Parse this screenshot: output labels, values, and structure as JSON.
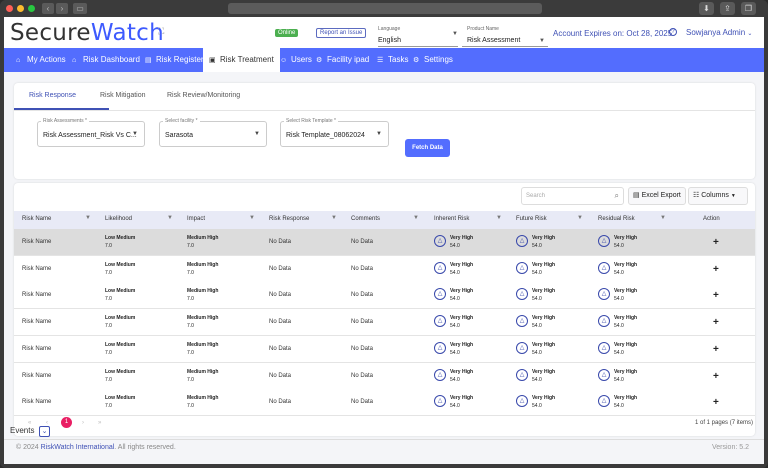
{
  "browser": {
    "back": "‹",
    "forward": "›"
  },
  "header": {
    "logo_a": "Secure",
    "logo_b": "Watch",
    "status": "Online",
    "report": "Report an Issue",
    "language_label": "Language",
    "language_value": "English",
    "product_label": "Product Name",
    "product_value": "Risk Assessment",
    "expires": "Account Expires on: Oct 28, 2025",
    "user": "Sowjanya Admin"
  },
  "menu": {
    "items": [
      {
        "label": "My Actions",
        "icon": "home-icon"
      },
      {
        "label": "Risk Dashboard",
        "icon": "home-icon"
      },
      {
        "label": "Risk Register",
        "icon": "register-icon"
      },
      {
        "label": "Risk Treatment",
        "icon": "treatment-icon"
      },
      {
        "label": "Users",
        "icon": "users-icon"
      },
      {
        "label": "Facility ipad",
        "icon": "gear-icon"
      },
      {
        "label": "Tasks",
        "icon": "list-icon"
      },
      {
        "label": "Settings",
        "icon": "gear-icon"
      }
    ]
  },
  "tabs": [
    "Risk Response",
    "Risk Mitigation",
    "Risk Review/Monitoring"
  ],
  "filters": {
    "assessments": {
      "label": "Risk Assessments *",
      "value": "Risk Assessment_Risk Vs C..."
    },
    "facility": {
      "label": "Select facility *",
      "value": "Sarasota"
    },
    "template": {
      "label": "Select Risk Template *",
      "value": "Risk Template_08062024"
    },
    "fetch": "Fetch Data"
  },
  "toolbar": {
    "search_placeholder": "Search",
    "excel": "Excel Export",
    "columns": "Columns"
  },
  "table": {
    "columns": [
      "Risk Name",
      "Likelihood",
      "Impact",
      "Risk Response",
      "Comments",
      "Inherent Risk",
      "Future Risk",
      "Residual Risk",
      "Action"
    ],
    "rows": [
      {
        "name": "Risk Name",
        "lik_label": "Low Medium",
        "lik_val": "7.0",
        "imp_label": "Medium High",
        "imp_val": "7.0",
        "response": "No Data",
        "comments": "No Data",
        "inh_label": "Very High",
        "inh_val": "54.0",
        "fut_label": "Very High",
        "fut_val": "54.0",
        "res_label": "Very High",
        "res_val": "54.0"
      },
      {
        "name": "Risk Name",
        "lik_label": "Low Medium",
        "lik_val": "7.0",
        "imp_label": "Medium High",
        "imp_val": "7.0",
        "response": "No Data",
        "comments": "No Data",
        "inh_label": "Very High",
        "inh_val": "54.0",
        "fut_label": "Very High",
        "fut_val": "54.0",
        "res_label": "Very High",
        "res_val": "54.0"
      },
      {
        "name": "Risk Name",
        "lik_label": "Low Medium",
        "lik_val": "7.0",
        "imp_label": "Medium High",
        "imp_val": "7.0",
        "response": "No Data",
        "comments": "No Data",
        "inh_label": "Very High",
        "inh_val": "54.0",
        "fut_label": "Very High",
        "fut_val": "54.0",
        "res_label": "Very High",
        "res_val": "54.0"
      },
      {
        "name": "Risk Name",
        "lik_label": "Low Medium",
        "lik_val": "7.0",
        "imp_label": "Medium High",
        "imp_val": "7.0",
        "response": "No Data",
        "comments": "No Data",
        "inh_label": "Very High",
        "inh_val": "54.0",
        "fut_label": "Very High",
        "fut_val": "54.0",
        "res_label": "Very High",
        "res_val": "54.0"
      },
      {
        "name": "Risk Name",
        "lik_label": "Low Medium",
        "lik_val": "7.0",
        "imp_label": "Medium High",
        "imp_val": "7.0",
        "response": "No Data",
        "comments": "No Data",
        "inh_label": "Very High",
        "inh_val": "54.0",
        "fut_label": "Very High",
        "fut_val": "54.0",
        "res_label": "Very High",
        "res_val": "54.0"
      },
      {
        "name": "Risk Name",
        "lik_label": "Low Medium",
        "lik_val": "7.0",
        "imp_label": "Medium High",
        "imp_val": "7.0",
        "response": "No Data",
        "comments": "No Data",
        "inh_label": "Very High",
        "inh_val": "54.0",
        "fut_label": "Very High",
        "fut_val": "54.0",
        "res_label": "Very High",
        "res_val": "54.0"
      },
      {
        "name": "Risk Name",
        "lik_label": "Low Medium",
        "lik_val": "7.0",
        "imp_label": "Medium High",
        "imp_val": "7.0",
        "response": "No Data",
        "comments": "No Data",
        "inh_label": "Very High",
        "inh_val": "54.0",
        "fut_label": "Very High",
        "fut_val": "54.0",
        "res_label": "Very High",
        "res_val": "54.0"
      }
    ],
    "action_symbol": "+"
  },
  "pagination": {
    "current": "1",
    "info": "1 of 1 pages (7 items)"
  },
  "footer": {
    "events": "Events",
    "copy_prefix": "© 2024 ",
    "copy_link": "RiskWatch International",
    "copy_suffix": ". All rights reserved.",
    "version": "Version: 5.2"
  },
  "colors": {
    "accent": "#536dfe",
    "brand": "#3f51b5",
    "online": "#4caf50",
    "page_active": "#e91e63"
  }
}
